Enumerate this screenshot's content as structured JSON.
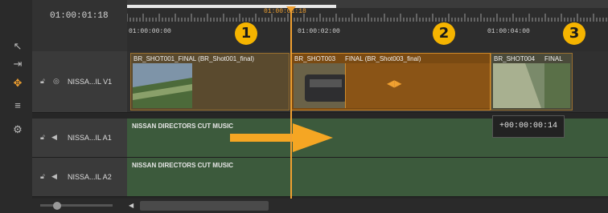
{
  "header": {
    "timecode": "01:00:01:18"
  },
  "ruler": {
    "playhead_label": "01:00:01:18",
    "ticks": [
      "01:00:00:00",
      "01:00:02:00",
      "01:00:04:00"
    ]
  },
  "tracks": {
    "v1": {
      "name": "NISSA...IL V1"
    },
    "a1": {
      "name": "NISSA...IL A1"
    },
    "a2": {
      "name": "NISSA...IL A2"
    }
  },
  "clips": {
    "shot001": "BR_SHOT001_FINAL (BR_Shot001_final)",
    "shot003_a": "BR_SHOT003",
    "shot003_b": "FINAL (BR_Shot003_final)",
    "shot004_a": "BR_SHOT004",
    "shot004_b": "FINAL",
    "music1": "NISSAN DIRECTORS CUT MUSIC",
    "music2": "NISSAN DIRECTORS CUT MUSIC"
  },
  "tooltip": {
    "offset": "+00:00:00:14"
  },
  "markers": [
    "1",
    "2",
    "3"
  ],
  "colors": {
    "accent": "#f5b400",
    "playhead": "#f0a030",
    "selection": "#7a4a12",
    "audio": "#3c5a3c"
  }
}
